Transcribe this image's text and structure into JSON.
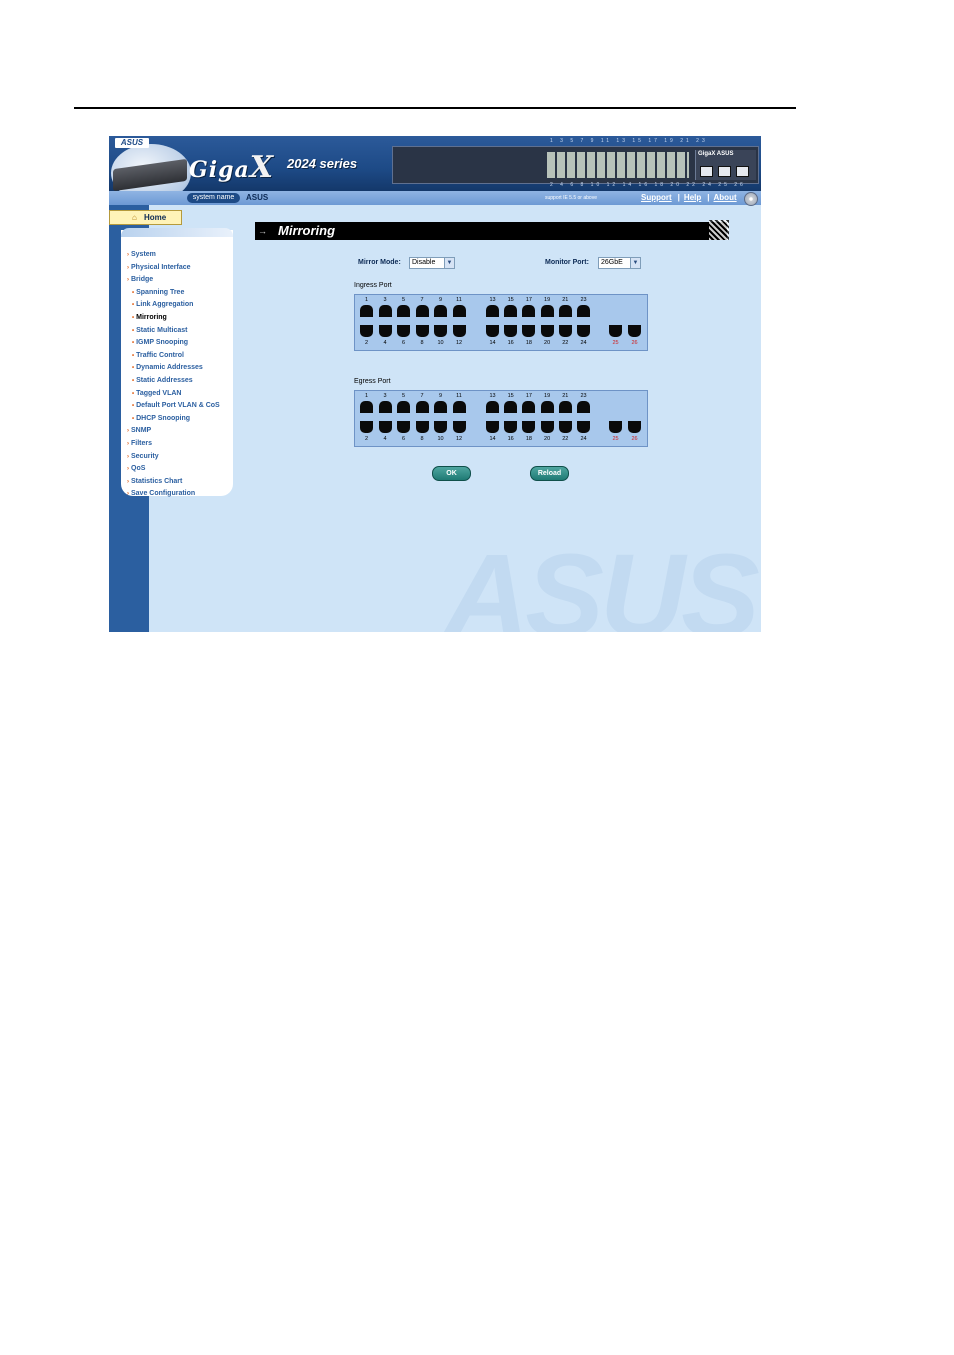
{
  "header": {
    "asus_logo": "ASUS",
    "brand_prefix": "Giga",
    "brand_x": "X",
    "series": "2024 series",
    "panel_brand": "GigaX ASUS",
    "top_port_labels": "1 3 5 7 9 11 13 15 17 19 21 23",
    "bottom_port_labels": "2 4 6 8 10 12 14 16 18 20 22 24 25 26"
  },
  "navbar": {
    "system_name_label": "system name",
    "system_name_value": "ASUS",
    "support_note": "support IE 5.5 or above",
    "links": [
      "Support",
      "Help",
      "About"
    ]
  },
  "sidebar": {
    "home_label": "Home",
    "items": [
      {
        "label": "System",
        "level": 0
      },
      {
        "label": "Physical Interface",
        "level": 0
      },
      {
        "label": "Bridge",
        "level": 0
      },
      {
        "label": "Spanning Tree",
        "level": 1
      },
      {
        "label": "Link Aggregation",
        "level": 1
      },
      {
        "label": "Mirroring",
        "level": 1,
        "active": true
      },
      {
        "label": "Static Multicast",
        "level": 1
      },
      {
        "label": "IGMP Snooping",
        "level": 1
      },
      {
        "label": "Traffic Control",
        "level": 1
      },
      {
        "label": "Dynamic Addresses",
        "level": 1
      },
      {
        "label": "Static Addresses",
        "level": 1
      },
      {
        "label": "Tagged VLAN",
        "level": 1
      },
      {
        "label": "Default Port VLAN & CoS",
        "level": 1
      },
      {
        "label": "DHCP Snooping",
        "level": 1
      },
      {
        "label": "SNMP",
        "level": 0
      },
      {
        "label": "Filters",
        "level": 0
      },
      {
        "label": "Security",
        "level": 0
      },
      {
        "label": "QoS",
        "level": 0
      },
      {
        "label": "Statistics Chart",
        "level": 0
      },
      {
        "label": "Save Configuration",
        "level": 0
      }
    ]
  },
  "main": {
    "title": "Mirroring",
    "mirror_mode_label": "Mirror Mode:",
    "mirror_mode_value": "Disable",
    "monitor_port_label": "Monitor Port:",
    "monitor_port_value": "26GbE",
    "ingress_label": "Ingress Port",
    "egress_label": "Egress Port",
    "top_ports": [
      "1",
      "3",
      "5",
      "7",
      "9",
      "11",
      "13",
      "15",
      "17",
      "19",
      "21",
      "23"
    ],
    "bottom_ports": [
      "2",
      "4",
      "6",
      "8",
      "10",
      "12",
      "14",
      "16",
      "18",
      "20",
      "22",
      "24"
    ],
    "gig_ports": [
      "25",
      "26"
    ],
    "ok_label": "OK",
    "reload_label": "Reload",
    "watermark": "ASUS"
  },
  "colors": {
    "background": "#cfe4f7",
    "header": "#1d4a86",
    "gig_port_number": "#d02020",
    "button": "#1f7a74"
  }
}
